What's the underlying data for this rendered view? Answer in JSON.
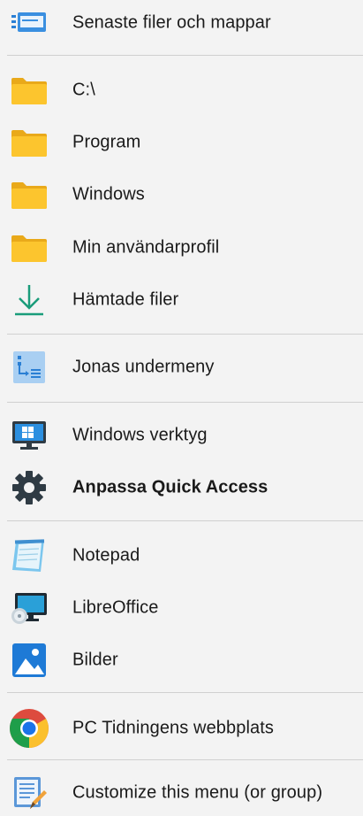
{
  "menu": {
    "items": [
      {
        "label": "Senaste filer och mappar",
        "icon": "recent-files-icon"
      },
      {
        "label": "C:\\",
        "icon": "folder-icon"
      },
      {
        "label": "Program",
        "icon": "folder-icon"
      },
      {
        "label": "Windows",
        "icon": "folder-icon"
      },
      {
        "label": "Min användarprofil",
        "icon": "folder-icon"
      },
      {
        "label": "Hämtade filer",
        "icon": "download-icon"
      },
      {
        "label": "Jonas undermeny",
        "icon": "submenu-icon"
      },
      {
        "label": "Windows verktyg",
        "icon": "windows-tools-icon"
      },
      {
        "label": "Anpassa Quick Access",
        "icon": "gear-icon"
      },
      {
        "label": "Notepad",
        "icon": "notepad-icon"
      },
      {
        "label": "LibreOffice",
        "icon": "libreoffice-icon"
      },
      {
        "label": "Bilder",
        "icon": "pictures-icon"
      },
      {
        "label": "PC Tidningens webbplats",
        "icon": "chrome-icon"
      },
      {
        "label": "Customize this menu (or group)",
        "icon": "customize-icon"
      }
    ]
  },
  "colors": {
    "folder": "#f9c42c",
    "download": "#1a9c7a",
    "accent_blue": "#1e7ad6",
    "gear": "#2f3b44",
    "separator": "#d0d0d0",
    "background": "#f3f3f3"
  }
}
